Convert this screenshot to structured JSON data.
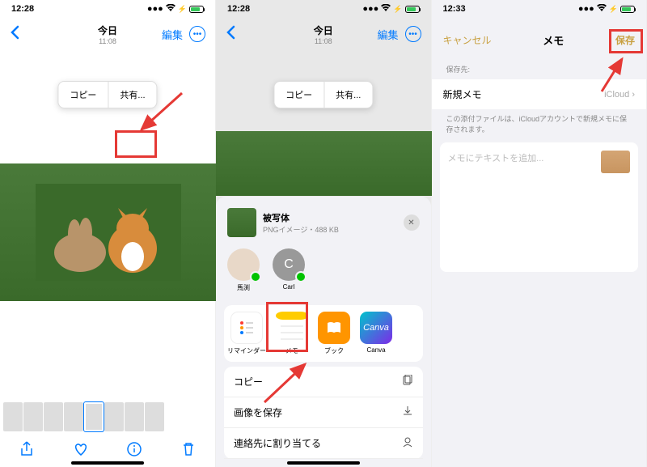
{
  "screen1": {
    "status_time": "12:28",
    "nav": {
      "title": "今日",
      "subtitle": "11:08",
      "edit": "編集"
    },
    "popover": {
      "copy": "コピー",
      "share": "共有..."
    }
  },
  "screen2": {
    "status_time": "12:28",
    "nav": {
      "title": "今日",
      "subtitle": "11:08",
      "edit": "編集"
    },
    "popover": {
      "copy": "コピー",
      "share": "共有..."
    },
    "sheet": {
      "title": "被写体",
      "subtitle": "PNGイメージ・488 KB",
      "contacts": [
        {
          "name": "馬渕"
        },
        {
          "name": "Carl",
          "initial": "C"
        }
      ],
      "apps": [
        {
          "name": "リマインダー",
          "bg": "#fff"
        },
        {
          "name": "メモ",
          "bg": "#fff"
        },
        {
          "name": "ブック",
          "bg": "#ff9500"
        },
        {
          "name": "Canva",
          "bg": "#00c4cc"
        }
      ],
      "actions": [
        {
          "label": "コピー"
        },
        {
          "label": "画像を保存"
        },
        {
          "label": "連絡先に割り当てる"
        }
      ]
    }
  },
  "screen3": {
    "status_time": "12:33",
    "nav": {
      "cancel": "キャンセル",
      "title": "メモ",
      "save": "保存"
    },
    "section_label": "保存先:",
    "dest_row": {
      "label": "新規メモ",
      "right": "iCloud"
    },
    "note": "この添付ファイルは、iCloudアカウントで新規メモに保存されます。",
    "body_placeholder": "メモにテキストを追加..."
  }
}
